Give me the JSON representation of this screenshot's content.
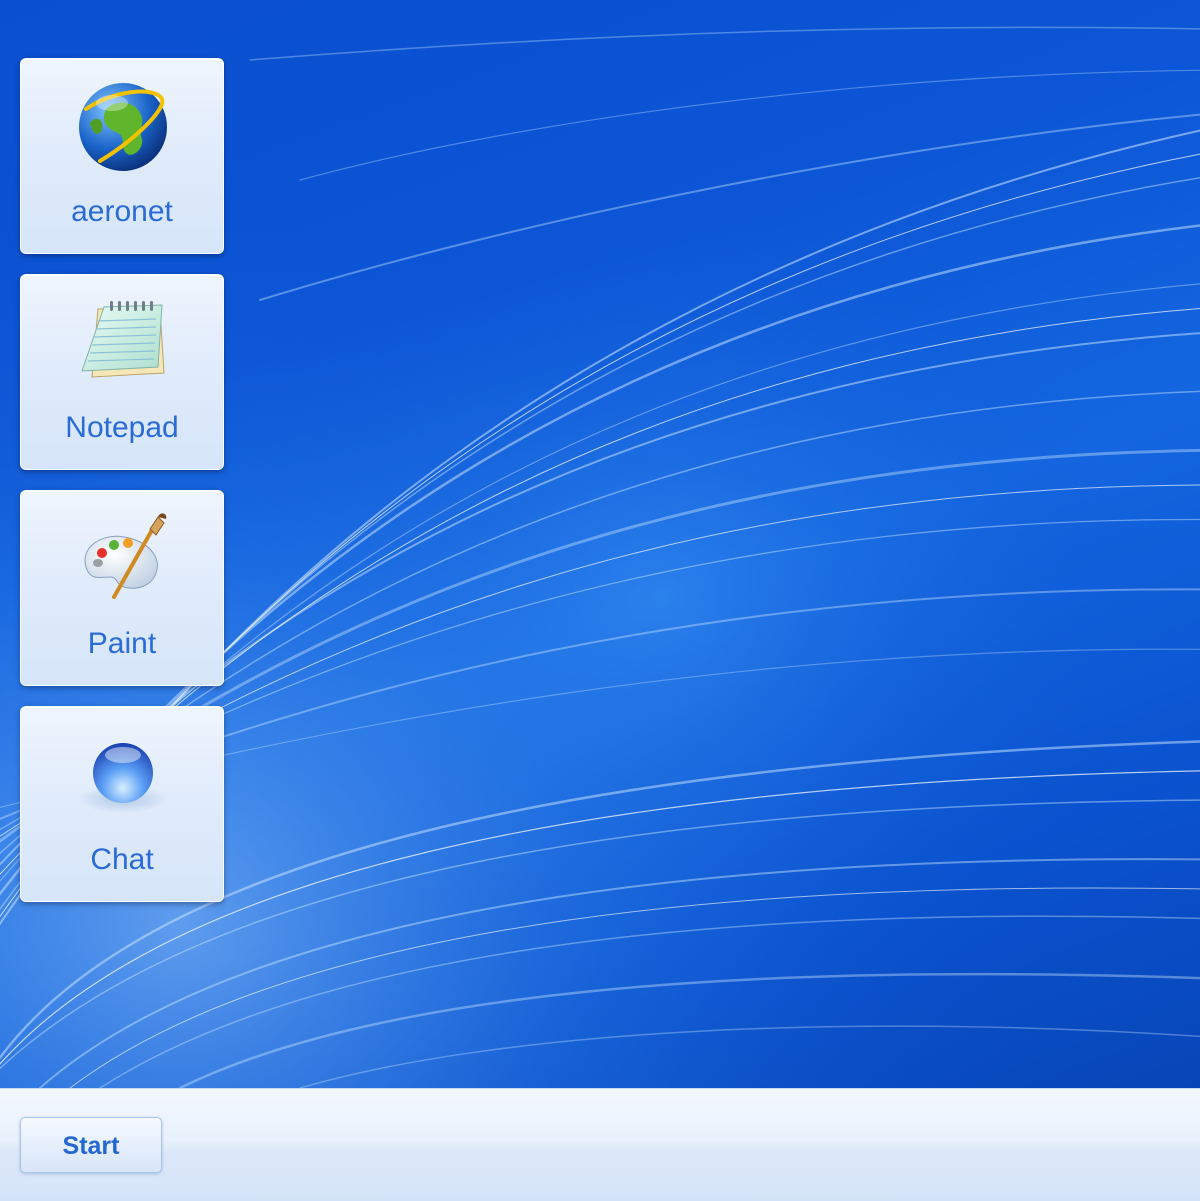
{
  "desktop": {
    "icons": [
      {
        "label": "aeronet",
        "icon": "globe-icon"
      },
      {
        "label": "Notepad",
        "icon": "notepad-icon"
      },
      {
        "label": "Paint",
        "icon": "paint-palette-icon"
      },
      {
        "label": "Chat",
        "icon": "chat-orb-icon"
      }
    ]
  },
  "taskbar": {
    "start_label": "Start"
  },
  "colors": {
    "wallpaper": "#0b55d6",
    "icon_label": "#2a6bd6",
    "start_text": "#2468cf",
    "taskbar": "#e4eefb"
  }
}
